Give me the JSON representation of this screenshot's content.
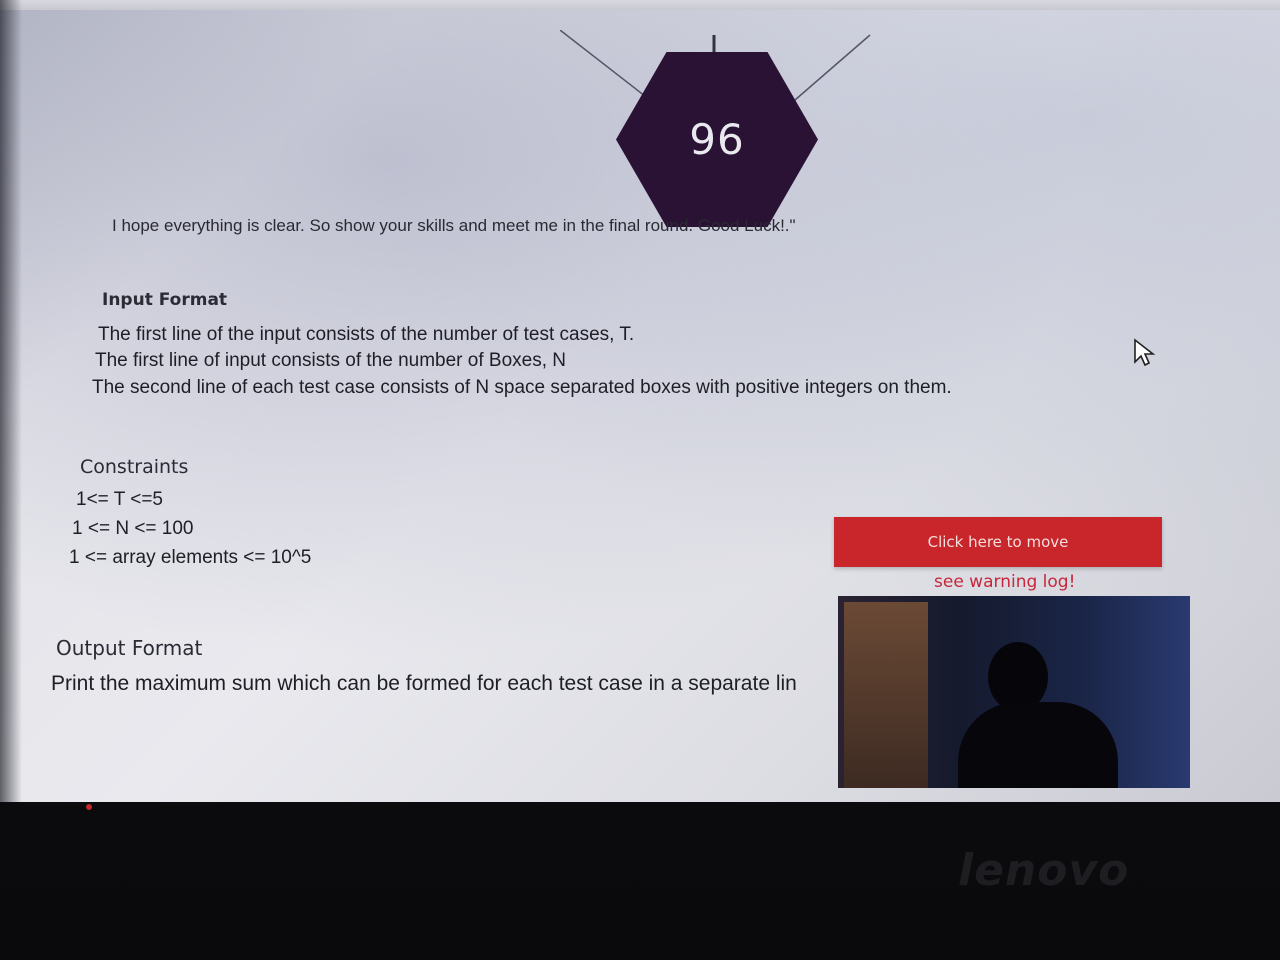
{
  "timer": {
    "value": "96"
  },
  "intro": {
    "text": "I hope everything is clear. So show your skills and meet me in the final round. Good Luck!.\""
  },
  "input_format": {
    "heading": "Input Format",
    "lines": [
      "The first line of the input consists of the number of test cases, T.",
      "The first line of input consists of the number of Boxes, N",
      "The second line of each test case consists of N space separated boxes with positive integers on them."
    ]
  },
  "constraints": {
    "heading": "Constraints",
    "lines": [
      "1<= T <=5",
      "1 <= N <= 100",
      "1 <= array elements <= 10^5"
    ]
  },
  "output_format": {
    "heading": "Output Format",
    "line": "Print the maximum sum which can be formed for each test case in a separate lin"
  },
  "proctor": {
    "move_button_label": "Click here to move",
    "warning_link": "see warning log!"
  },
  "device": {
    "brand": "lenovo"
  },
  "colors": {
    "accent": "#c8262b",
    "hexagon": "#2a1234",
    "warning": "#c8263a"
  },
  "icons": {
    "cursor": "mouse-pointer-icon"
  }
}
